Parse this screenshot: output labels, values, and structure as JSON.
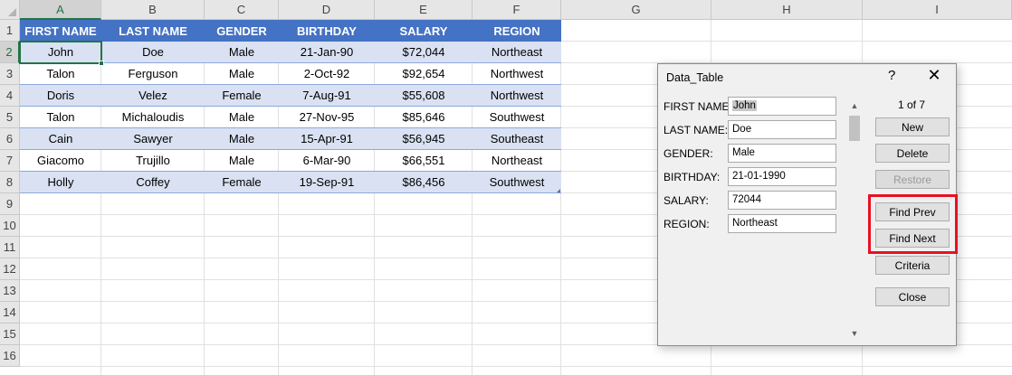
{
  "columns": [
    "A",
    "B",
    "C",
    "D",
    "E",
    "F",
    "G",
    "H",
    "I"
  ],
  "rows": [
    "1",
    "2",
    "3",
    "4",
    "5",
    "6",
    "7",
    "8",
    "9",
    "10",
    "11",
    "12",
    "13",
    "14",
    "15",
    "16"
  ],
  "table": {
    "headers": [
      "FIRST NAME",
      "LAST NAME",
      "GENDER",
      "BIRTHDAY",
      "SALARY",
      "REGION"
    ],
    "data": [
      [
        "John",
        "Doe",
        "Male",
        "21-Jan-90",
        "$72,044",
        "Northeast"
      ],
      [
        "Talon",
        "Ferguson",
        "Male",
        "2-Oct-92",
        "$92,654",
        "Northwest"
      ],
      [
        "Doris",
        "Velez",
        "Female",
        "7-Aug-91",
        "$55,608",
        "Northwest"
      ],
      [
        "Talon",
        "Michaloudis",
        "Male",
        "27-Nov-95",
        "$85,646",
        "Southwest"
      ],
      [
        "Cain",
        "Sawyer",
        "Male",
        "15-Apr-91",
        "$56,945",
        "Southeast"
      ],
      [
        "Giacomo",
        "Trujillo",
        "Male",
        "6-Mar-90",
        "$66,551",
        "Northeast"
      ],
      [
        "Holly",
        "Coffey",
        "Female",
        "19-Sep-91",
        "$86,456",
        "Southwest"
      ]
    ]
  },
  "dialog": {
    "title": "Data_Table",
    "help": "?",
    "close_glyph": "✕",
    "record_counter": "1 of 7",
    "fields": [
      {
        "label": "FIRST NAME:",
        "value": "John"
      },
      {
        "label": "LAST NAME:",
        "value": "Doe"
      },
      {
        "label": "GENDER:",
        "value": "Male"
      },
      {
        "label": "BIRTHDAY:",
        "value": "21-01-1990"
      },
      {
        "label": "SALARY:",
        "value": "72044"
      },
      {
        "label": "REGION:",
        "value": "Northeast"
      }
    ],
    "buttons": {
      "new": "New",
      "delete": "Delete",
      "restore": "Restore",
      "find_prev": "Find Prev",
      "find_next": "Find Next",
      "criteria": "Criteria",
      "close": "Close"
    },
    "scroll_up": "▲",
    "scroll_down": "▼"
  },
  "colors": {
    "header_fill": "#4472c4",
    "band_fill": "#d9e1f2",
    "selection": "#217346",
    "highlight_box": "#e81123"
  }
}
